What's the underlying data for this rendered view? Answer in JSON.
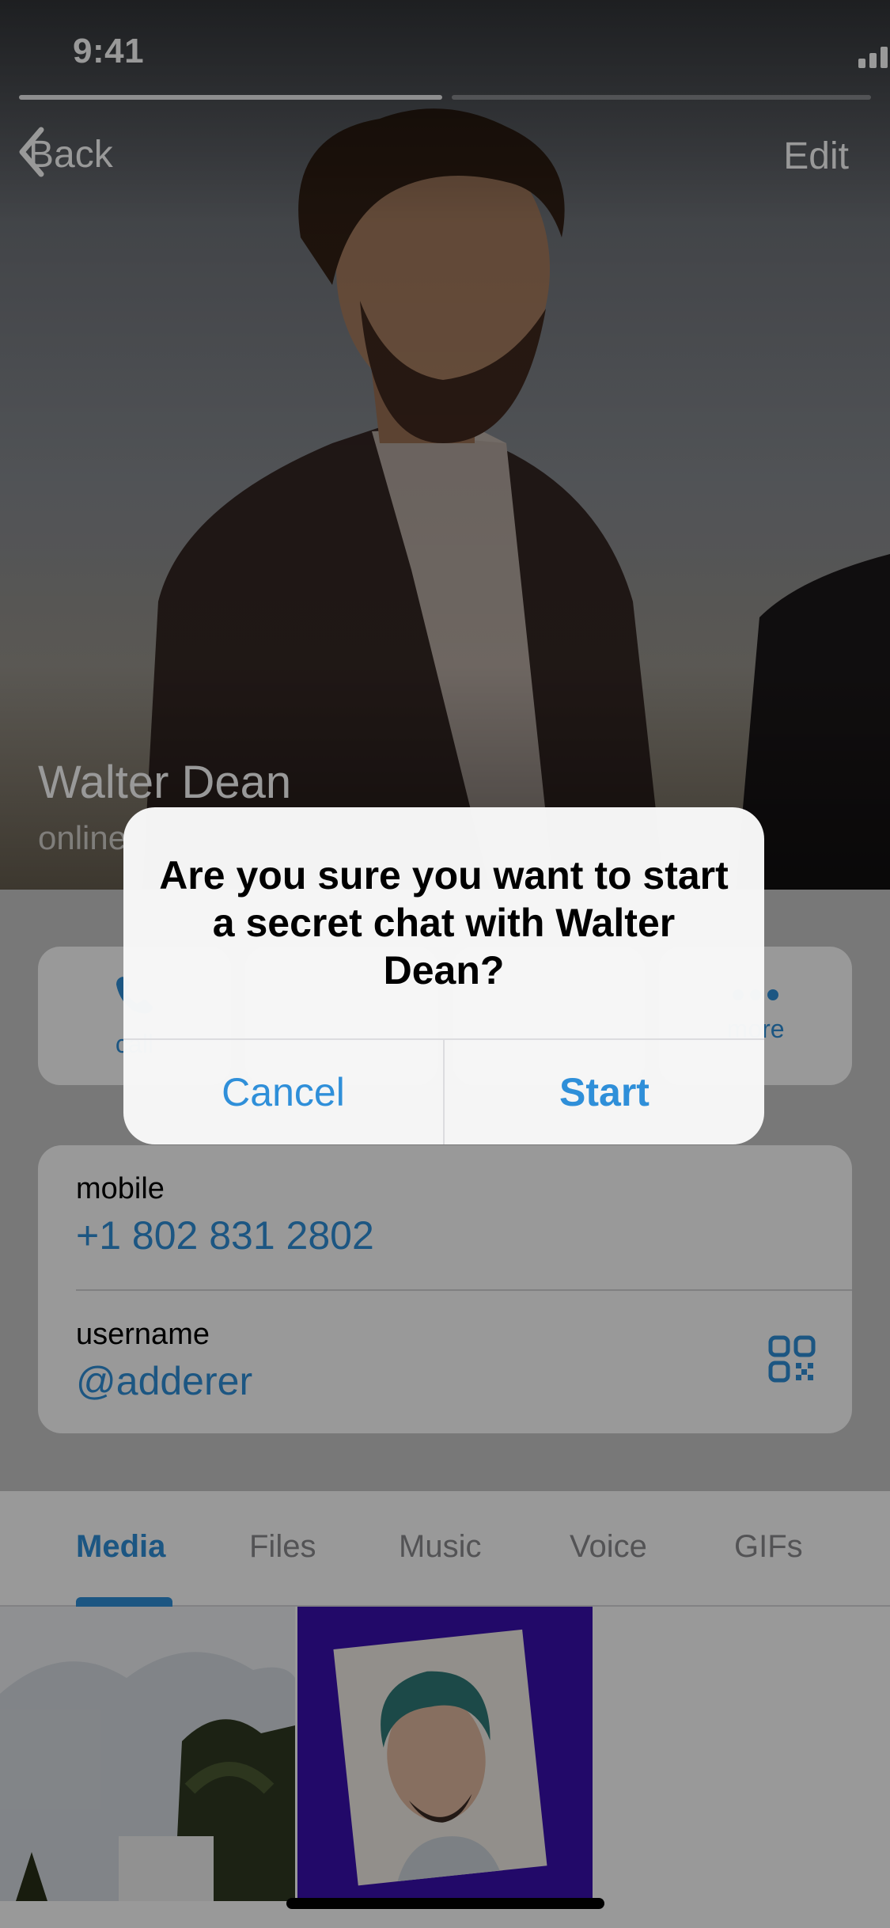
{
  "status_bar": {
    "time": "9:41"
  },
  "nav": {
    "back_label": "Back",
    "edit_label": "Edit"
  },
  "profile": {
    "name": "Walter Dean",
    "status": "online"
  },
  "actions": [
    {
      "label": "call",
      "icon": "phone-icon"
    },
    {
      "label": "more",
      "icon": "more-icon"
    }
  ],
  "info": {
    "mobile_label": "mobile",
    "mobile_value": "+1 802 831 2802",
    "username_label": "username",
    "username_value": "@adderer"
  },
  "tabs": [
    {
      "label": "Media",
      "active": true
    },
    {
      "label": "Files",
      "active": false
    },
    {
      "label": "Music",
      "active": false
    },
    {
      "label": "Voice",
      "active": false
    },
    {
      "label": "GIFs",
      "active": false
    }
  ],
  "alert": {
    "message": "Are you sure you want to start a secret chat with Walter Dean?",
    "cancel_label": "Cancel",
    "start_label": "Start"
  },
  "colors": {
    "accent": "#2f8fd9",
    "media_bg": "#3a0fb0"
  }
}
